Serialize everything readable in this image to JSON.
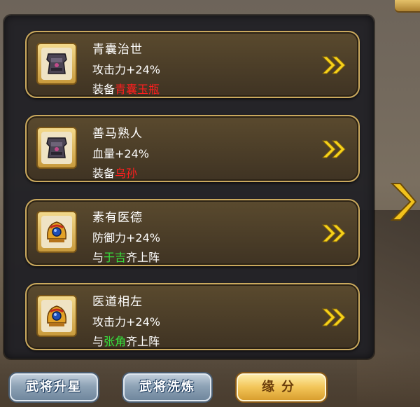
{
  "cards": [
    {
      "title": "青囊治世",
      "stat": "攻击力+24%",
      "req_prefix": "装备",
      "req_highlight": "青囊玉瓶",
      "req_suffix": "",
      "highlight_color": "#ff1e1e",
      "portrait": "dark-armor-icon"
    },
    {
      "title": "善马熟人",
      "stat": "血量+24%",
      "req_prefix": "装备",
      "req_highlight": "乌孙",
      "req_suffix": "",
      "highlight_color": "#ff1e1e",
      "portrait": "dark-armor-icon"
    },
    {
      "title": "素有医德",
      "stat": "防御力+24%",
      "req_prefix": "与",
      "req_highlight": "于吉",
      "req_suffix": "齐上阵",
      "highlight_color": "#36e03c",
      "portrait": "golden-helmet-icon"
    },
    {
      "title": "医道相左",
      "stat": "攻击力+24%",
      "req_prefix": "与",
      "req_highlight": "张角",
      "req_suffix": "齐上阵",
      "highlight_color": "#36e03c",
      "portrait": "golden-helmet-icon"
    }
  ],
  "buttons": {
    "upgrade_star": "武将升星",
    "reroll": "武将洗炼",
    "fate": "缘分"
  },
  "colors": {
    "card_border": "#caa95e",
    "chevron": "#f7d21a"
  }
}
